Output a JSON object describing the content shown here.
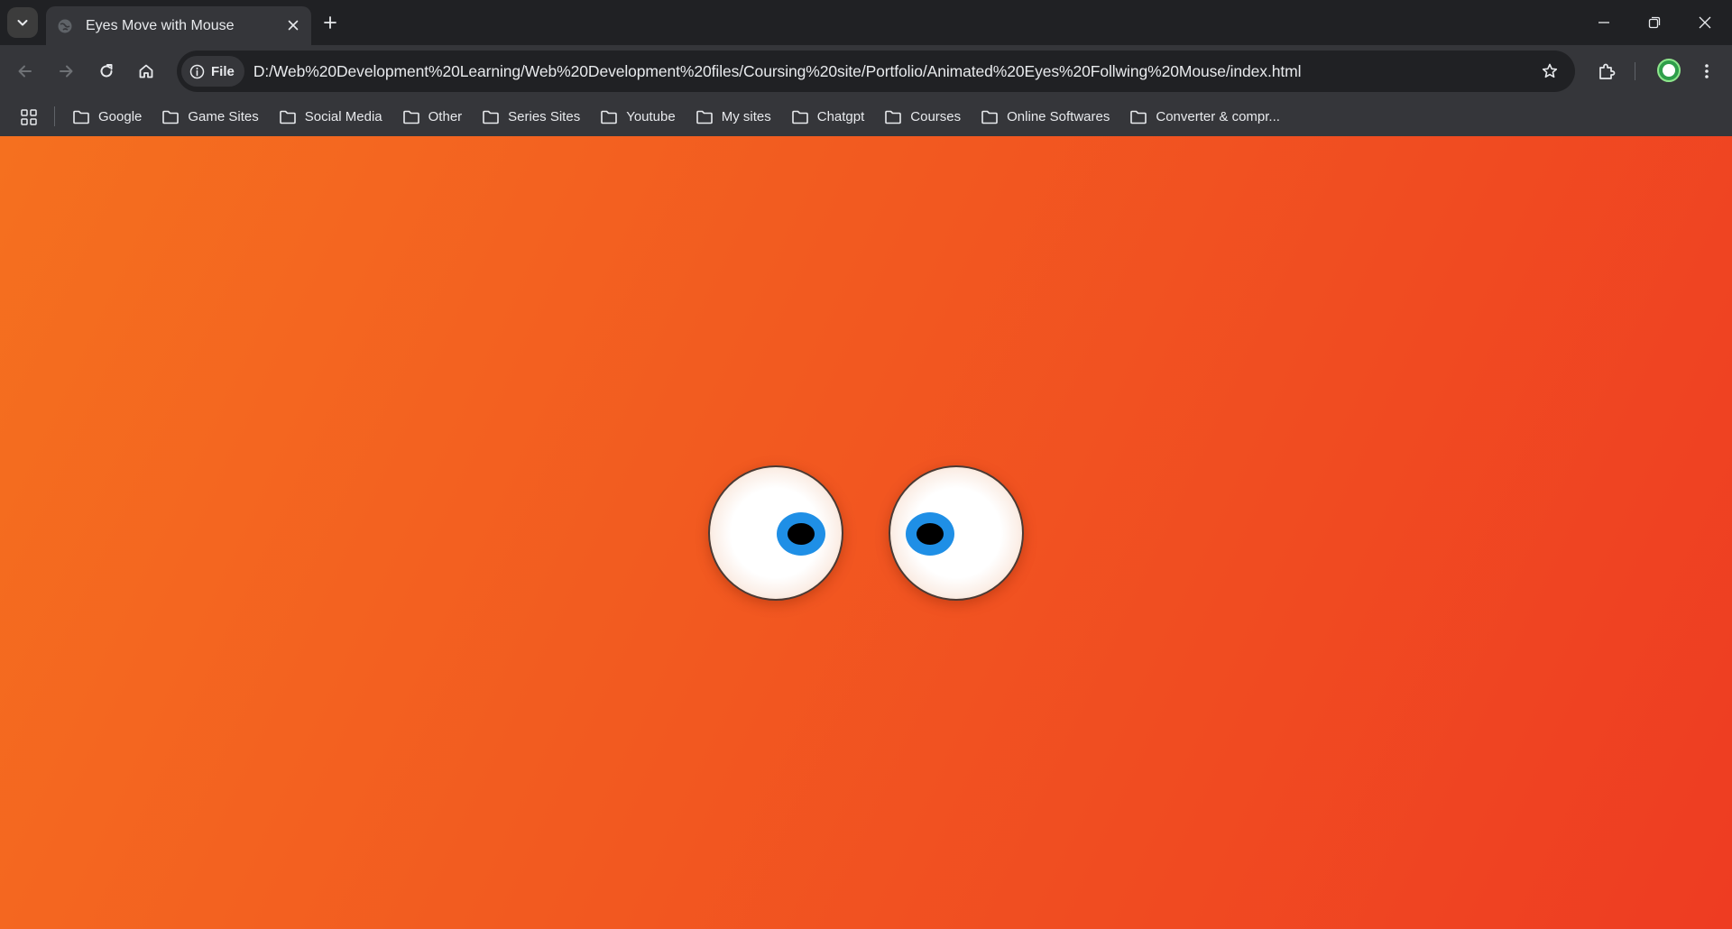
{
  "browser": {
    "tab": {
      "title": "Eyes Move with Mouse"
    },
    "omnibox": {
      "chip_label": "File",
      "url": "D:/Web%20Development%20Learning/Web%20Development%20files/Coursing%20site/Portfolio/Animated%20Eyes%20Follwing%20Mouse/index.html"
    },
    "bookmarks": [
      {
        "label": "Google"
      },
      {
        "label": "Game Sites"
      },
      {
        "label": "Social Media"
      },
      {
        "label": "Other"
      },
      {
        "label": "Series Sites"
      },
      {
        "label": "Youtube"
      },
      {
        "label": "My sites"
      },
      {
        "label": "Chatgpt"
      },
      {
        "label": "Courses"
      },
      {
        "label": "Online Softwares"
      },
      {
        "label": "Converter & compr..."
      }
    ]
  },
  "page": {
    "background_colors": [
      "#f5701f",
      "#ee3c22"
    ],
    "iris_color": "#1f8fe6",
    "pupil_color": "#000000"
  }
}
